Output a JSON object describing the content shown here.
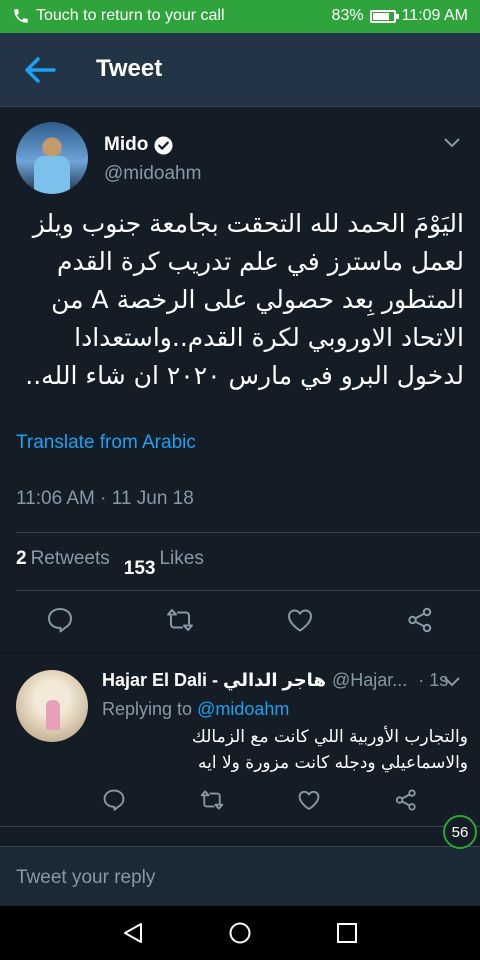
{
  "status_bar": {
    "call_text": "Touch to return to your call",
    "battery": "83%",
    "battery_level": 0.83,
    "time": "11:09 AM"
  },
  "header": {
    "title": "Tweet"
  },
  "tweet": {
    "name": "Mido",
    "handle": "@midoahm",
    "text": "اليَوْمَ الحمد لله التحقت بجامعة جنوب ويلز لعمل ماسترز في علم تدريب كرة القدم المتطور بِعد حصولي على الرخصة A من الاتحاد الاوروبي لكرة القدم..واستعدادا لدخول البرو في مارس ٢٠٢٠ ان شاء الله..",
    "translate": "Translate from Arabic",
    "timestamp": "11:06 AM · 11 Jun 18",
    "retweets_count": "2",
    "retweets_label": "Retweets",
    "likes_count": "153",
    "likes_label": "Likes"
  },
  "reply": {
    "name": "Hajar El Dali - هاجر الدالي",
    "handle": "@Hajar...",
    "time": "· 1s",
    "replying_label": "Replying to",
    "replying_to": "@midoahm",
    "text": "والتجارب الأوربية اللي كانت مع الزمالك والاسماعيلي ودجله كانت مزورة ولا ايه"
  },
  "compose": {
    "placeholder": "Tweet your reply",
    "counter": "56"
  },
  "colors": {
    "accent": "#1da1f2",
    "background": "#141d26",
    "status_green": "#2fa33c",
    "like": "#e0245e"
  },
  "icons": [
    "phone-icon",
    "battery-icon",
    "back-arrow-icon",
    "verified-icon",
    "chevron-down-icon",
    "reply-icon",
    "retweet-icon",
    "like-icon",
    "share-icon",
    "nav-back-icon",
    "nav-home-icon",
    "nav-recents-icon"
  ]
}
